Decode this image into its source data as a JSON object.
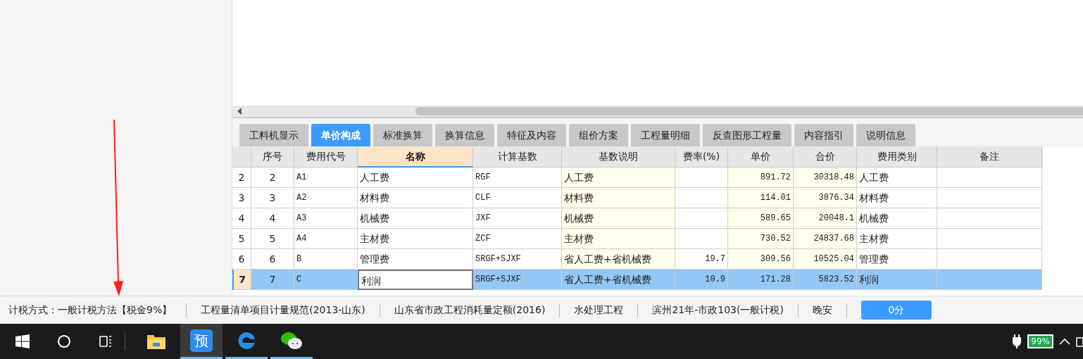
{
  "tabs": [
    {
      "label": "工料机显示",
      "selected": false
    },
    {
      "label": "单价构成",
      "selected": true
    },
    {
      "label": "标准换算",
      "selected": false
    },
    {
      "label": "换算信息",
      "selected": false
    },
    {
      "label": "特征及内容",
      "selected": false
    },
    {
      "label": "组价方案",
      "selected": false
    },
    {
      "label": "工程量明细",
      "selected": false
    },
    {
      "label": "反查图形工程量",
      "selected": false
    },
    {
      "label": "内容指引",
      "selected": false
    },
    {
      "label": "说明信息",
      "selected": false
    }
  ],
  "table": {
    "columns": [
      {
        "selected": false
      },
      {
        "label": "序号",
        "selected": false
      },
      {
        "label": "费用代号",
        "selected": false
      },
      {
        "label": "名称",
        "selected": true
      },
      {
        "label": "计算基数",
        "selected": false
      },
      {
        "label": "基数说明",
        "selected": false
      },
      {
        "label": "费率(%)",
        "selected": false
      },
      {
        "label": "单价",
        "selected": false
      },
      {
        "label": "合价",
        "selected": false
      },
      {
        "label": "费用类别",
        "selected": false
      },
      {
        "label": "备注",
        "selected": false
      }
    ],
    "rows": [
      {
        "selected": false,
        "cells": [
          "2",
          "2",
          "A1",
          "人工费",
          "RGF",
          "人工费",
          "",
          "891.72",
          "30318.48",
          "人工费",
          ""
        ]
      },
      {
        "selected": false,
        "cells": [
          "3",
          "3",
          "A2",
          "材料费",
          "CLF",
          "材料费",
          "",
          "114.01",
          "3876.34",
          "材料费",
          ""
        ]
      },
      {
        "selected": false,
        "cells": [
          "4",
          "4",
          "A3",
          "机械费",
          "JXF",
          "机械费",
          "",
          "589.65",
          "20048.1",
          "机械费",
          ""
        ]
      },
      {
        "selected": false,
        "cells": [
          "5",
          "5",
          "A4",
          "主材费",
          "ZCF",
          "主材费",
          "",
          "730.52",
          "24837.68",
          "主材费",
          ""
        ]
      },
      {
        "selected": false,
        "cells": [
          "6",
          "6",
          "B",
          "管理费",
          "SRGF+SJXF",
          "省人工费+省机械费",
          "19.7",
          "309.56",
          "10525.04",
          "管理费",
          ""
        ]
      },
      {
        "selected": true,
        "cells": [
          "7",
          "7",
          "C",
          "利润",
          "SRGF+SJXF",
          "省人工费+省机械费",
          "10.9",
          "171.28",
          "5823.52",
          "利润",
          ""
        ]
      }
    ]
  },
  "status_bar": {
    "items": [
      "计税方式：一般计税方法【税金9%】",
      "工程量清单项目计量规范(2013-山东)",
      "山东省市政工程消耗量定额(2016)",
      "水处理工程",
      "滨州21年-市政103(一般计税)",
      "晚安"
    ],
    "button": "0分"
  },
  "taskbar": {
    "apps": [
      {
        "kind": "folder",
        "selected": false,
        "running": false
      },
      {
        "kind": "text",
        "label": "预",
        "selected": true,
        "running": true
      },
      {
        "kind": "edge",
        "selected": false,
        "running": true
      },
      {
        "kind": "wechat",
        "selected": false,
        "running": true
      }
    ],
    "battery": "99%"
  }
}
